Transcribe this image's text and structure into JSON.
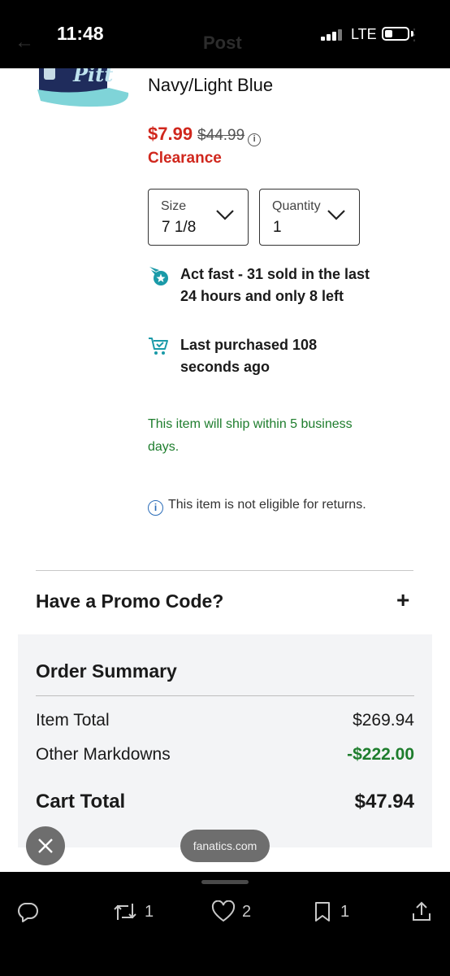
{
  "status_bar": {
    "time": "11:48",
    "network": "LTE",
    "behind_title": "Post"
  },
  "product": {
    "variant": "Navy/Light Blue",
    "sale_price": "$7.99",
    "original_price": "$44.99",
    "clearance": "Clearance",
    "cap_logo_text": "Pitt"
  },
  "size_select": {
    "label": "Size",
    "value": "7 1/8"
  },
  "quantity_select": {
    "label": "Quantity",
    "value": "1"
  },
  "urgency": {
    "sold": "Act fast - 31 sold in the last 24 hours and only 8 left",
    "purchased": "Last purchased 108 seconds ago"
  },
  "shipping": "This item will ship within 5 business days.",
  "returns": "This item is not eligible for returns.",
  "promo": {
    "label": "Have a Promo Code?",
    "toggle": "+"
  },
  "summary": {
    "title": "Order Summary",
    "item_total_label": "Item Total",
    "item_total_value": "$269.94",
    "markdowns_label": "Other Markdowns",
    "markdowns_value": "-$222.00",
    "cart_total_label": "Cart Total",
    "cart_total_value": "$47.94"
  },
  "overlay": {
    "site": "fanatics.com"
  },
  "actions": {
    "retweets": "1",
    "likes": "2",
    "bookmarks": "1"
  },
  "colors": {
    "sale_red": "#d0271d",
    "ship_green": "#1e7d2d",
    "urgency_teal": "#1a9aa8",
    "info_blue": "#2a6cb8"
  }
}
